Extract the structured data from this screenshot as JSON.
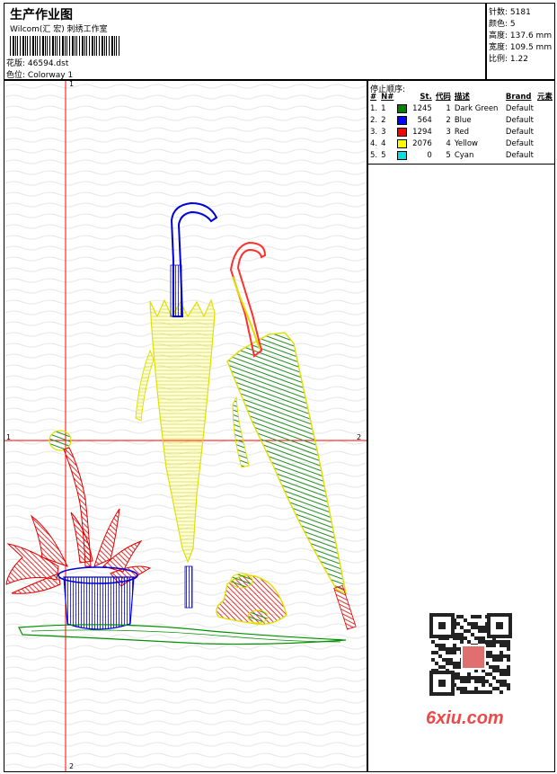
{
  "header": {
    "title": "生产作业图",
    "subtitle": "Wilcom(汇 宏) 刺绣工作室",
    "design_label": "花版:",
    "design_value": "46594.dst",
    "colorway_label": "色位:",
    "colorway_value": "Colorway 1"
  },
  "stats": {
    "stitches_label": "针数:",
    "stitches_value": "5181",
    "colors_label": "颜色:",
    "colors_value": "5",
    "height_label": "高度:",
    "height_value": "137.6 mm",
    "width_label": "宽度:",
    "width_value": "109.5 mm",
    "scale_label": "比例:",
    "scale_value": "1.22"
  },
  "stop_sequence": {
    "title": "停止顺序:",
    "headers": [
      "#",
      "N#",
      "St.",
      "代码",
      "描述",
      "Brand",
      "元素"
    ],
    "rows": [
      {
        "num": "1.",
        "n": "1",
        "color": "#008000",
        "st": "1245",
        "code": "1",
        "desc": "Dark Green",
        "brand": "Default"
      },
      {
        "num": "2.",
        "n": "2",
        "color": "#0000ff",
        "st": "564",
        "code": "2",
        "desc": "Blue",
        "brand": "Default"
      },
      {
        "num": "3.",
        "n": "3",
        "color": "#ff0000",
        "st": "1294",
        "code": "3",
        "desc": "Red",
        "brand": "Default"
      },
      {
        "num": "4.",
        "n": "4",
        "color": "#ffff00",
        "st": "2076",
        "code": "4",
        "desc": "Yellow",
        "brand": "Default"
      },
      {
        "num": "5.",
        "n": "5",
        "color": "#00e0e0",
        "st": "0",
        "code": "5",
        "desc": "Cyan",
        "brand": "Default"
      }
    ]
  },
  "axes": {
    "top": "1",
    "bottom": "2",
    "left": "1",
    "right": "2"
  },
  "watermark": "6xiu.com"
}
